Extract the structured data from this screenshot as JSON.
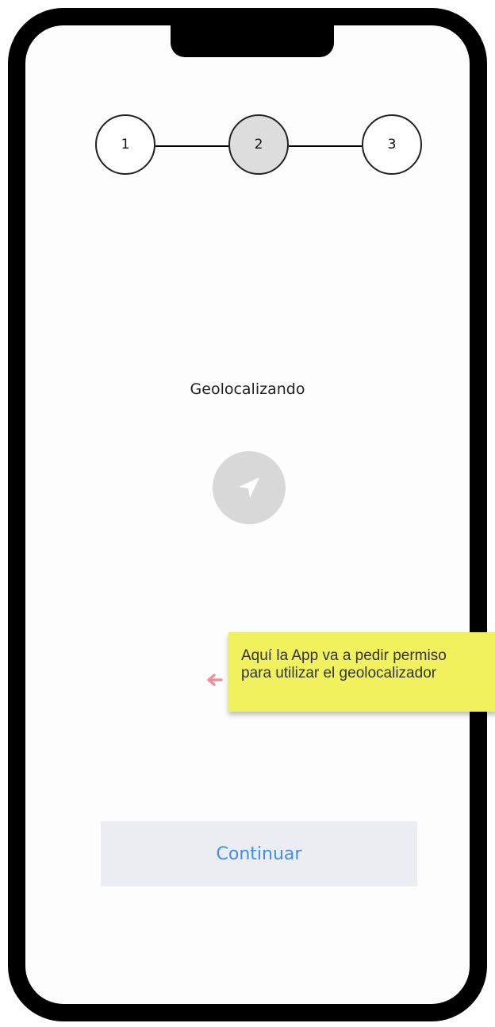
{
  "stepper": {
    "steps": [
      {
        "label": "1",
        "active": false
      },
      {
        "label": "2",
        "active": true
      },
      {
        "label": "3",
        "active": false
      }
    ]
  },
  "main": {
    "title": "Geolocalizando",
    "icon": "navigation-arrow-icon"
  },
  "annotation": {
    "line1": "Aquí la App va a pedir permiso",
    "line2": "para utilizar el geolocalizador",
    "arrow_icon": "left-arrow-icon",
    "arrow_color": "#f28b9a",
    "background": "#f1f15e"
  },
  "actions": {
    "continue_label": "Continuar",
    "continue_color": "#3d8fec"
  }
}
